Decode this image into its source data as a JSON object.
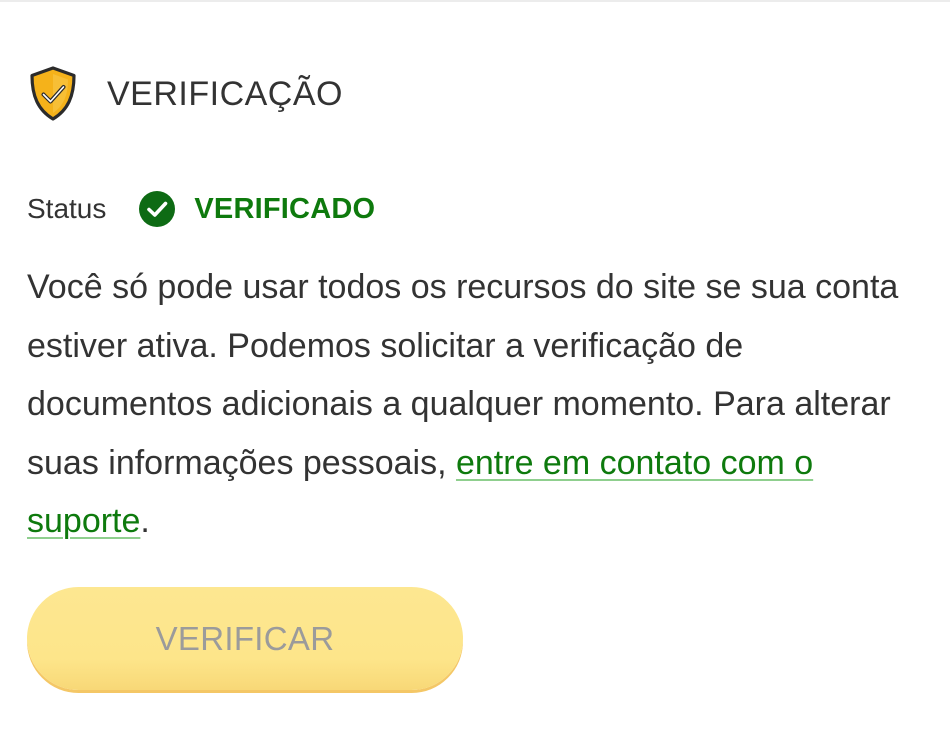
{
  "section": {
    "title": "VERIFICAÇÃO",
    "icon": "shield-check-icon",
    "icon_color": "#f5b21a"
  },
  "status": {
    "label": "Status",
    "value": "VERIFICADO",
    "icon": "check-circle-icon",
    "color": "#0e7a0d"
  },
  "description": {
    "text": "Você só pode usar todos os recursos do site se sua conta estiver ativa. Podemos solicitar a verificação de documentos adicionais a qualquer momento. Para alterar suas informações pessoais, ",
    "link_text": "entre em contato com o suporte",
    "suffix": "."
  },
  "actions": {
    "verify_label": "VERIFICAR",
    "verify_disabled": true,
    "button_color": "#fde58a"
  }
}
